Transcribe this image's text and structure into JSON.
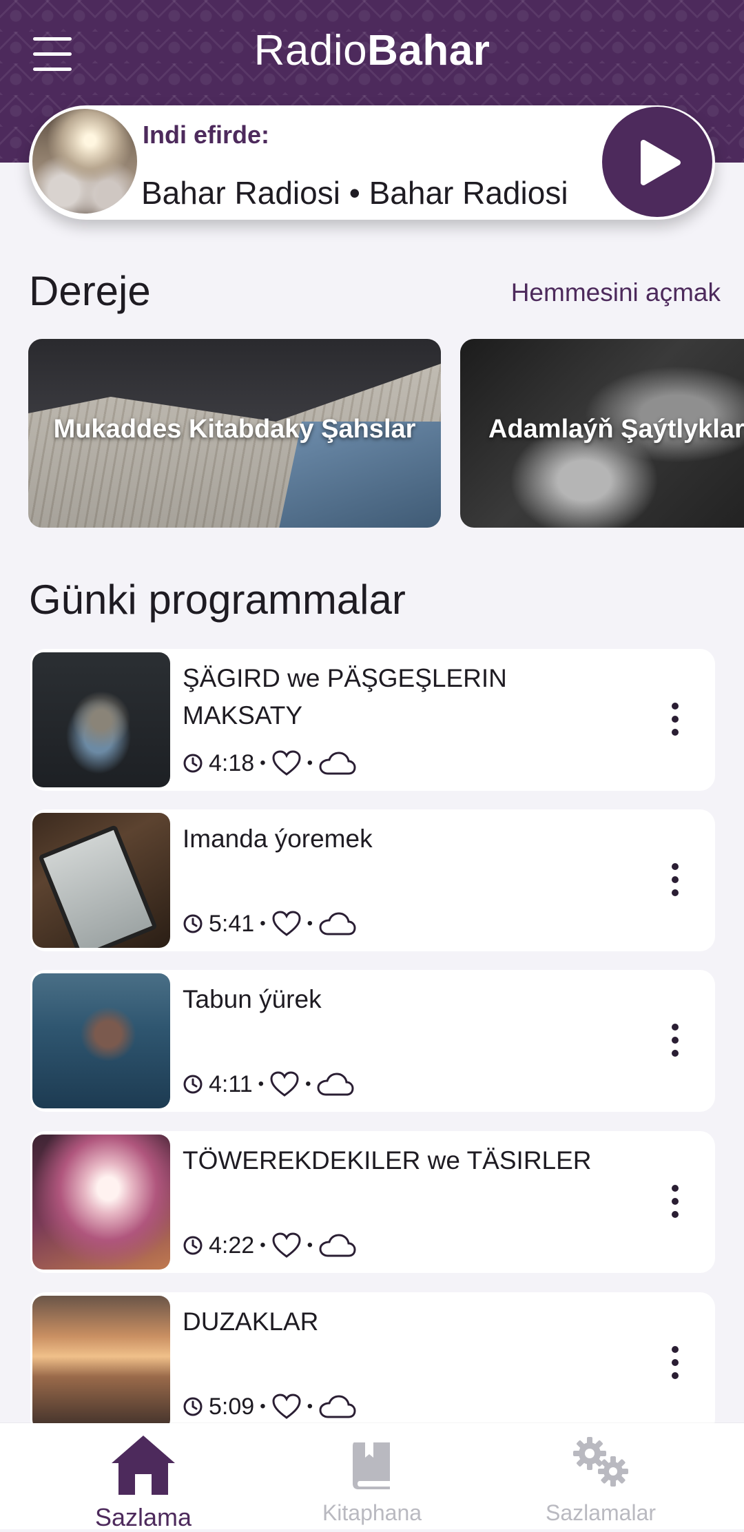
{
  "header": {
    "title_light": "Radio",
    "title_bold": "Bahar",
    "colors": {
      "brand": "#4d2a5c",
      "background": "#f4f3f8"
    }
  },
  "now_playing": {
    "label": "Indi efirde:",
    "title": "Bahar Radiosi • Bahar Radiosi"
  },
  "categories_section": {
    "title": "Dereje",
    "see_all": "Hemmesini açmak",
    "items": [
      {
        "label": "Mukaddes Kitabdaky Şahslar"
      },
      {
        "label": "Adamlaýň Şaýtlyklary"
      }
    ]
  },
  "programs_section": {
    "title": "Günki programmalar",
    "items": [
      {
        "title": "ŞÄGIRD we PÄŞGEŞLERIN MAKSATY",
        "duration": "4:18"
      },
      {
        "title": "Imanda ýoremek",
        "duration": "5:41"
      },
      {
        "title": "Tabun ýürek",
        "duration": "4:11"
      },
      {
        "title": "TÖWEREKDEKILER we TÄSIRLER",
        "duration": "4:22"
      },
      {
        "title": "DUZAKLAR",
        "duration": "5:09"
      }
    ]
  },
  "bottom_nav": {
    "items": [
      {
        "label": "Sazlama",
        "icon": "home-icon",
        "active": true
      },
      {
        "label": "Kitaphana",
        "icon": "book-icon",
        "active": false
      },
      {
        "label": "Sazlamalar",
        "icon": "gears-icon",
        "active": false
      }
    ]
  }
}
